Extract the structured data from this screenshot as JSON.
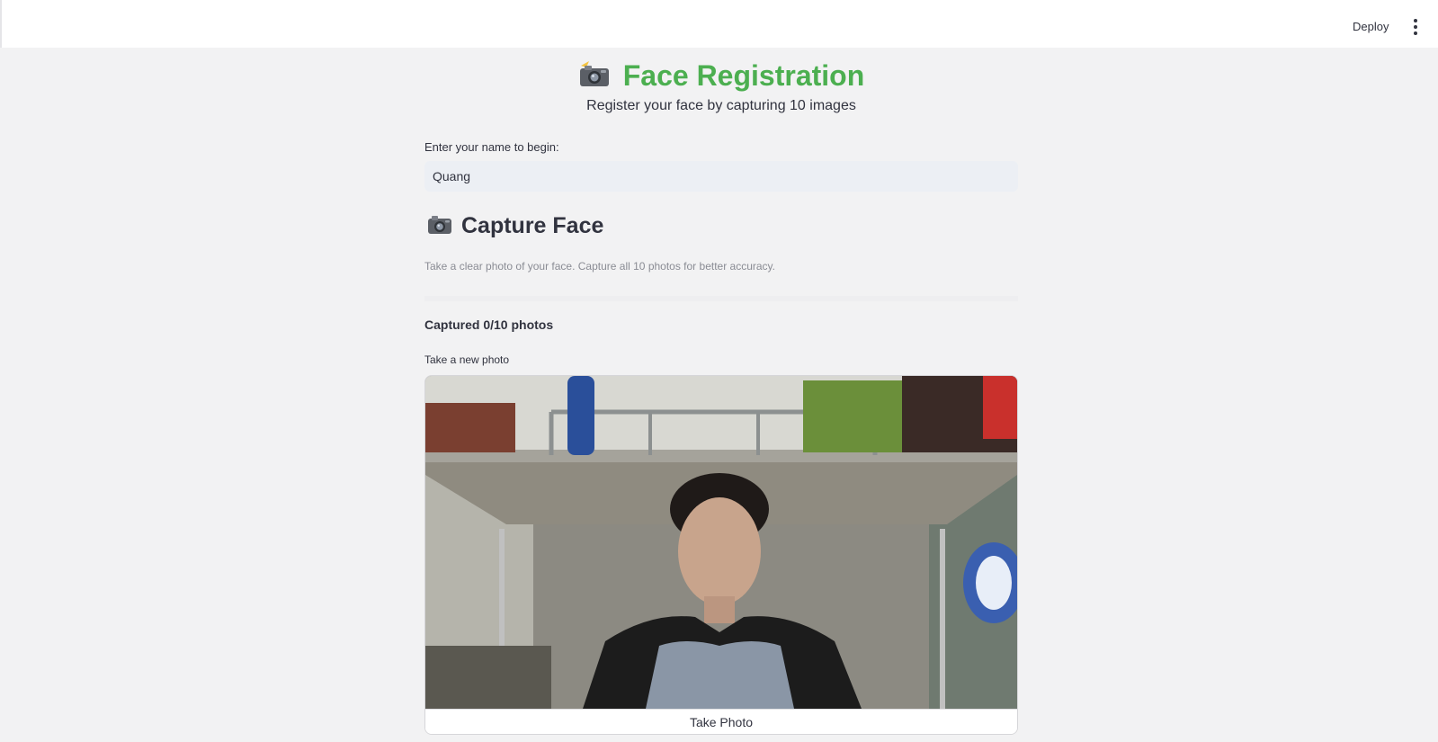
{
  "header": {
    "deploy_label": "Deploy",
    "menu_icon": "more-vertical-icon"
  },
  "page": {
    "title": "Face Registration",
    "title_icon": "camera-flash-icon",
    "title_color": "#4caf50",
    "subtitle": "Register your face by capturing 10 images"
  },
  "name_form": {
    "label": "Enter your name to begin:",
    "value": "Quang"
  },
  "capture": {
    "heading": "Capture Face",
    "heading_icon": "camera-icon",
    "caption": "Take a clear photo of your face. Capture all 10 photos for better accuracy.",
    "count_text": "Captured 0/10 photos",
    "photo_label": "Take a new photo",
    "take_photo_label": "Take Photo"
  }
}
